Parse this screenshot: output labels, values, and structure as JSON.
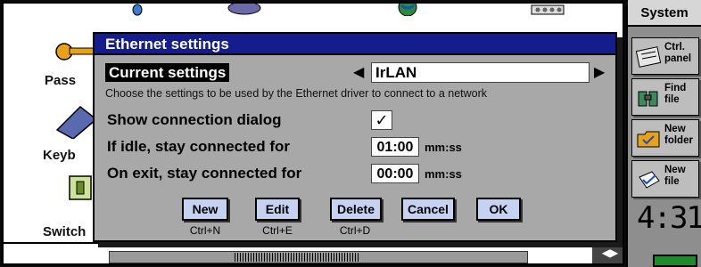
{
  "desktop": {
    "labels": [
      "Pass",
      "Keyb",
      "Switch"
    ]
  },
  "dialog": {
    "title": "Ethernet settings",
    "current_settings_label": "Current settings",
    "current_settings_value": "IrLAN",
    "hint": "Choose the settings to be used by the Ethernet driver to connect to a network",
    "show_connection_dialog_label": "Show connection dialog",
    "show_connection_dialog_checked": "✓",
    "idle_label": "If idle, stay connected for",
    "idle_value": "01:00",
    "idle_unit": "mm:ss",
    "exit_label": "On exit, stay connected for",
    "exit_value": "00:00",
    "exit_unit": "mm:ss",
    "buttons": [
      {
        "label": "New",
        "shortcut": "Ctrl+N"
      },
      {
        "label": "Edit",
        "shortcut": "Ctrl+E"
      },
      {
        "label": "Delete",
        "shortcut": "Ctrl+D"
      },
      {
        "label": "Cancel",
        "shortcut": ""
      },
      {
        "label": "OK",
        "shortcut": ""
      }
    ]
  },
  "toolbar": {
    "title": "System",
    "items": [
      {
        "label": "Ctrl. panel",
        "icon": "control-panel-icon"
      },
      {
        "label": "Find file",
        "icon": "binoculars-icon"
      },
      {
        "label": "New folder",
        "icon": "folder-icon"
      },
      {
        "label": "New file",
        "icon": "new-file-icon"
      }
    ],
    "clock": "4:31"
  },
  "colors": {
    "title_bar": "#151c8c",
    "button_face": "#c6d2f2",
    "battery": "#1e8a2c"
  }
}
